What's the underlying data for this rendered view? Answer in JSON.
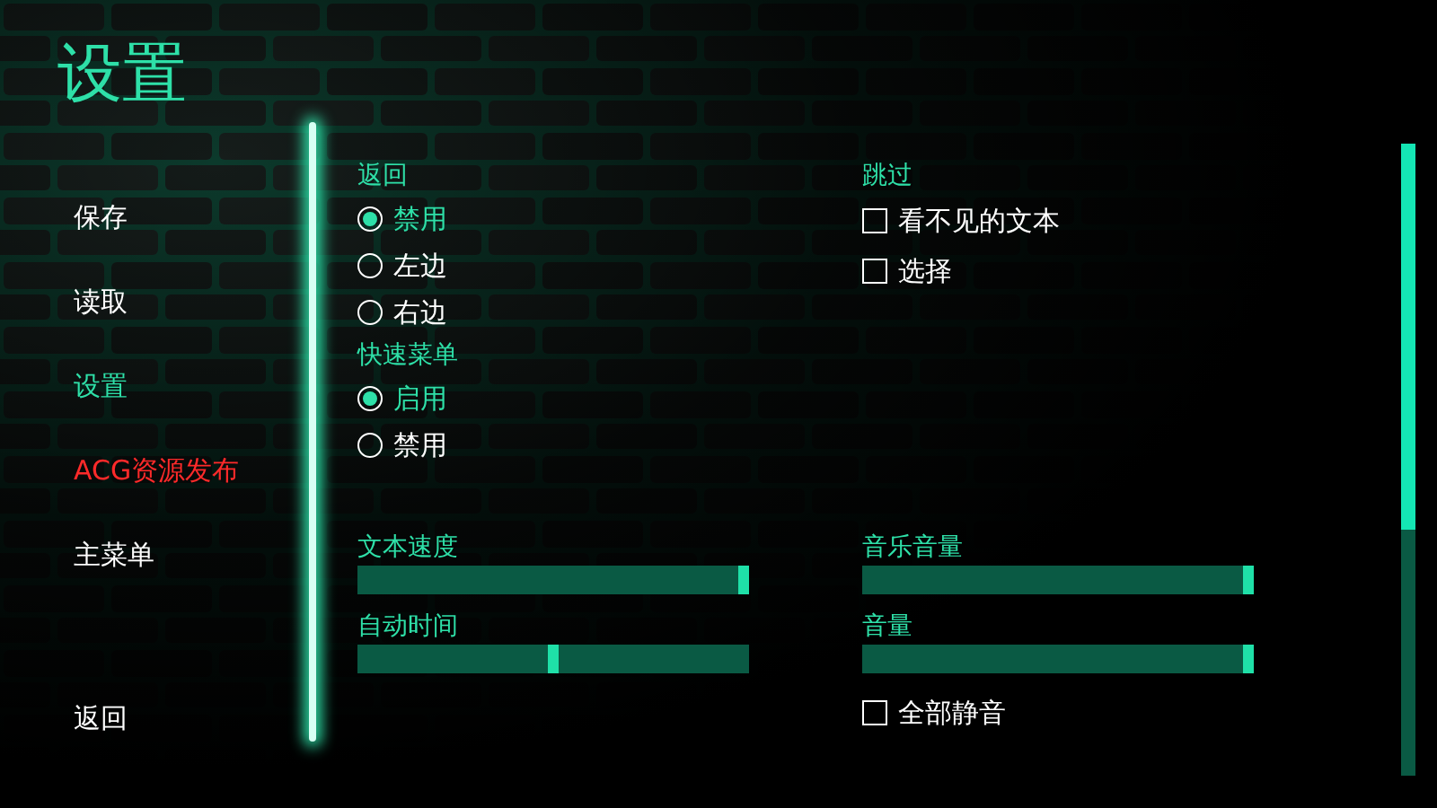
{
  "title": "设置",
  "nav": [
    {
      "label": "保存",
      "selected": false,
      "kind": "menu"
    },
    {
      "label": "读取",
      "selected": false,
      "kind": "menu"
    },
    {
      "label": "设置",
      "selected": true,
      "kind": "menu"
    },
    {
      "label": "ACG资源发布",
      "selected": false,
      "kind": "link"
    },
    {
      "label": "主菜单",
      "selected": false,
      "kind": "menu"
    },
    {
      "label": "返回",
      "selected": false,
      "kind": "menu"
    }
  ],
  "rollback": {
    "label": "返回",
    "options": [
      {
        "label": "禁用",
        "selected": true
      },
      {
        "label": "左边",
        "selected": false
      },
      {
        "label": "右边",
        "selected": false
      }
    ]
  },
  "quick_menu": {
    "label": "快速菜单",
    "options": [
      {
        "label": "启用",
        "selected": true
      },
      {
        "label": "禁用",
        "selected": false
      }
    ]
  },
  "skip": {
    "label": "跳过",
    "options": [
      {
        "label": "看不见的文本",
        "checked": false
      },
      {
        "label": "选择",
        "checked": false
      }
    ]
  },
  "text_sliders": [
    {
      "label": "文本速度",
      "level": 1.0
    },
    {
      "label": "自动时间",
      "level": 0.5
    }
  ],
  "volume_sliders": [
    {
      "label": "音乐音量",
      "level": 1.0
    },
    {
      "label": "音量",
      "level": 1.0
    }
  ],
  "mute_all": {
    "label": "全部静音",
    "checked": false
  }
}
